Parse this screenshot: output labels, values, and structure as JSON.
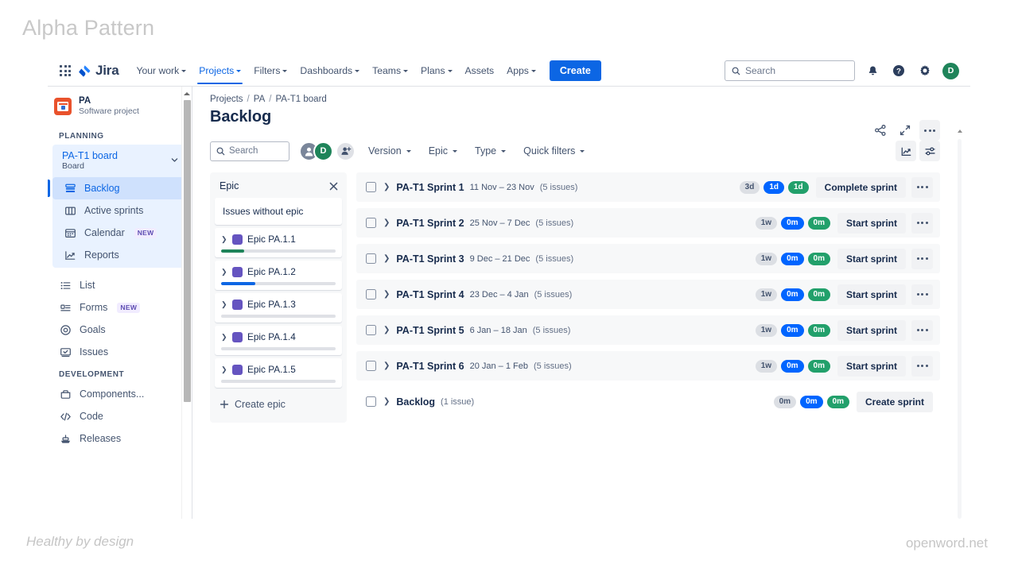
{
  "outer": {
    "title": "Alpha Pattern",
    "footer_left": "Healthy by design",
    "footer_right": "openword.net"
  },
  "topnav": {
    "app_switcher_icon": "grid-apps-icon",
    "logo_text": "Jira",
    "items": [
      {
        "label": "Your work",
        "has_caret": true,
        "active": false
      },
      {
        "label": "Projects",
        "has_caret": true,
        "active": true
      },
      {
        "label": "Filters",
        "has_caret": true,
        "active": false
      },
      {
        "label": "Dashboards",
        "has_caret": true,
        "active": false
      },
      {
        "label": "Teams",
        "has_caret": true,
        "active": false
      },
      {
        "label": "Plans",
        "has_caret": true,
        "active": false
      },
      {
        "label": "Assets",
        "has_caret": false,
        "active": false
      },
      {
        "label": "Apps",
        "has_caret": true,
        "active": false
      }
    ],
    "create_label": "Create",
    "search_placeholder": "Search",
    "notifications_icon": "bell-icon",
    "help_icon": "help-circle-icon",
    "settings_icon": "gear-icon",
    "avatar_initial": "D"
  },
  "sidebar": {
    "project_name": "PA",
    "project_type": "Software project",
    "planning_label": "PLANNING",
    "board": {
      "name": "PA-T1 board",
      "sub": "Board"
    },
    "planning_items": [
      {
        "label": "Backlog",
        "icon": "backlog-icon",
        "selected": true,
        "badge": ""
      },
      {
        "label": "Active sprints",
        "icon": "board-columns-icon",
        "selected": false,
        "badge": ""
      },
      {
        "label": "Calendar",
        "icon": "calendar-icon",
        "selected": false,
        "badge": "NEW"
      },
      {
        "label": "Reports",
        "icon": "reports-chart-icon",
        "selected": false,
        "badge": ""
      }
    ],
    "other_items": [
      {
        "label": "List",
        "icon": "list-icon",
        "badge": ""
      },
      {
        "label": "Forms",
        "icon": "forms-icon",
        "badge": "NEW"
      },
      {
        "label": "Goals",
        "icon": "goals-target-icon",
        "badge": ""
      },
      {
        "label": "Issues",
        "icon": "issues-icon",
        "badge": ""
      }
    ],
    "development_label": "DEVELOPMENT",
    "development_items": [
      {
        "label": "Components...",
        "icon": "components-icon",
        "badge": ""
      },
      {
        "label": "Code",
        "icon": "code-icon",
        "badge": ""
      },
      {
        "label": "Releases",
        "icon": "releases-ship-icon",
        "badge": ""
      }
    ]
  },
  "main": {
    "breadcrumb": [
      "Projects",
      "PA",
      "PA-T1 board"
    ],
    "page_title": "Backlog",
    "title_actions": [
      {
        "name": "share-icon"
      },
      {
        "name": "expand-icon"
      },
      {
        "name": "more-actions-icon"
      }
    ],
    "filterbar": {
      "search_placeholder": "Search",
      "avatars": [
        {
          "name": "avatar-anonymous",
          "initial": ""
        },
        {
          "name": "avatar-user-d",
          "initial": "D"
        }
      ],
      "add_people_icon": "add-person-icon",
      "dropdowns": [
        "Version",
        "Epic",
        "Type",
        "Quick filters"
      ],
      "insights_icon": "insights-chart-icon",
      "board-settings_icon": "sliders-icon"
    },
    "epic_panel": {
      "title": "Epic",
      "close_icon": "close-icon",
      "without_epic_label": "Issues without epic",
      "epics": [
        {
          "name": "Epic PA.1.1",
          "color": "#6554c0",
          "progress": 20,
          "bar_color": "#1f845a"
        },
        {
          "name": "Epic PA.1.2",
          "color": "#6554c0",
          "progress": 30,
          "bar_color": "#0c66e4"
        },
        {
          "name": "Epic PA.1.3",
          "color": "#6554c0",
          "progress": 0,
          "bar_color": "#1f845a"
        },
        {
          "name": "Epic PA.1.4",
          "color": "#6554c0",
          "progress": 0,
          "bar_color": "#1f845a"
        },
        {
          "name": "Epic PA.1.5",
          "color": "#6554c0",
          "progress": 0,
          "bar_color": "#1f845a"
        }
      ],
      "create_epic_label": "Create epic"
    },
    "sprints": [
      {
        "name": "PA-T1 Sprint 1",
        "dates": "11 Nov – 23 Nov",
        "issues": "(5 issues)",
        "estimates": [
          "3d",
          "1d",
          "1d"
        ],
        "action": "Complete sprint",
        "has_more": true
      },
      {
        "name": "PA-T1 Sprint 2",
        "dates": "25 Nov – 7 Dec",
        "issues": "(5 issues)",
        "estimates": [
          "1w",
          "0m",
          "0m"
        ],
        "action": "Start sprint",
        "has_more": true
      },
      {
        "name": "PA-T1 Sprint 3",
        "dates": "9 Dec – 21 Dec",
        "issues": "(5 issues)",
        "estimates": [
          "1w",
          "0m",
          "0m"
        ],
        "action": "Start sprint",
        "has_more": true
      },
      {
        "name": "PA-T1 Sprint 4",
        "dates": "23 Dec – 4 Jan",
        "issues": "(5 issues)",
        "estimates": [
          "1w",
          "0m",
          "0m"
        ],
        "action": "Start sprint",
        "has_more": true
      },
      {
        "name": "PA-T1 Sprint 5",
        "dates": "6 Jan – 18 Jan",
        "issues": "(5 issues)",
        "estimates": [
          "1w",
          "0m",
          "0m"
        ],
        "action": "Start sprint",
        "has_more": true
      },
      {
        "name": "PA-T1 Sprint 6",
        "dates": "20 Jan – 1 Feb",
        "issues": "(5 issues)",
        "estimates": [
          "1w",
          "0m",
          "0m"
        ],
        "action": "Start sprint",
        "has_more": true
      },
      {
        "name": "Backlog",
        "dates": "",
        "issues": "(1 issue)",
        "estimates": [
          "0m",
          "0m",
          "0m"
        ],
        "action": "Create sprint",
        "has_more": false
      }
    ]
  },
  "colors": {
    "brand_blue": "#0c66e4",
    "pill_blue": "#0065ff",
    "pill_green": "#22a06b",
    "pill_gray": "#dcdfe4",
    "epic_purple": "#6554c0",
    "project_icon": "#e9522c",
    "avatar_green": "#1f845a"
  }
}
